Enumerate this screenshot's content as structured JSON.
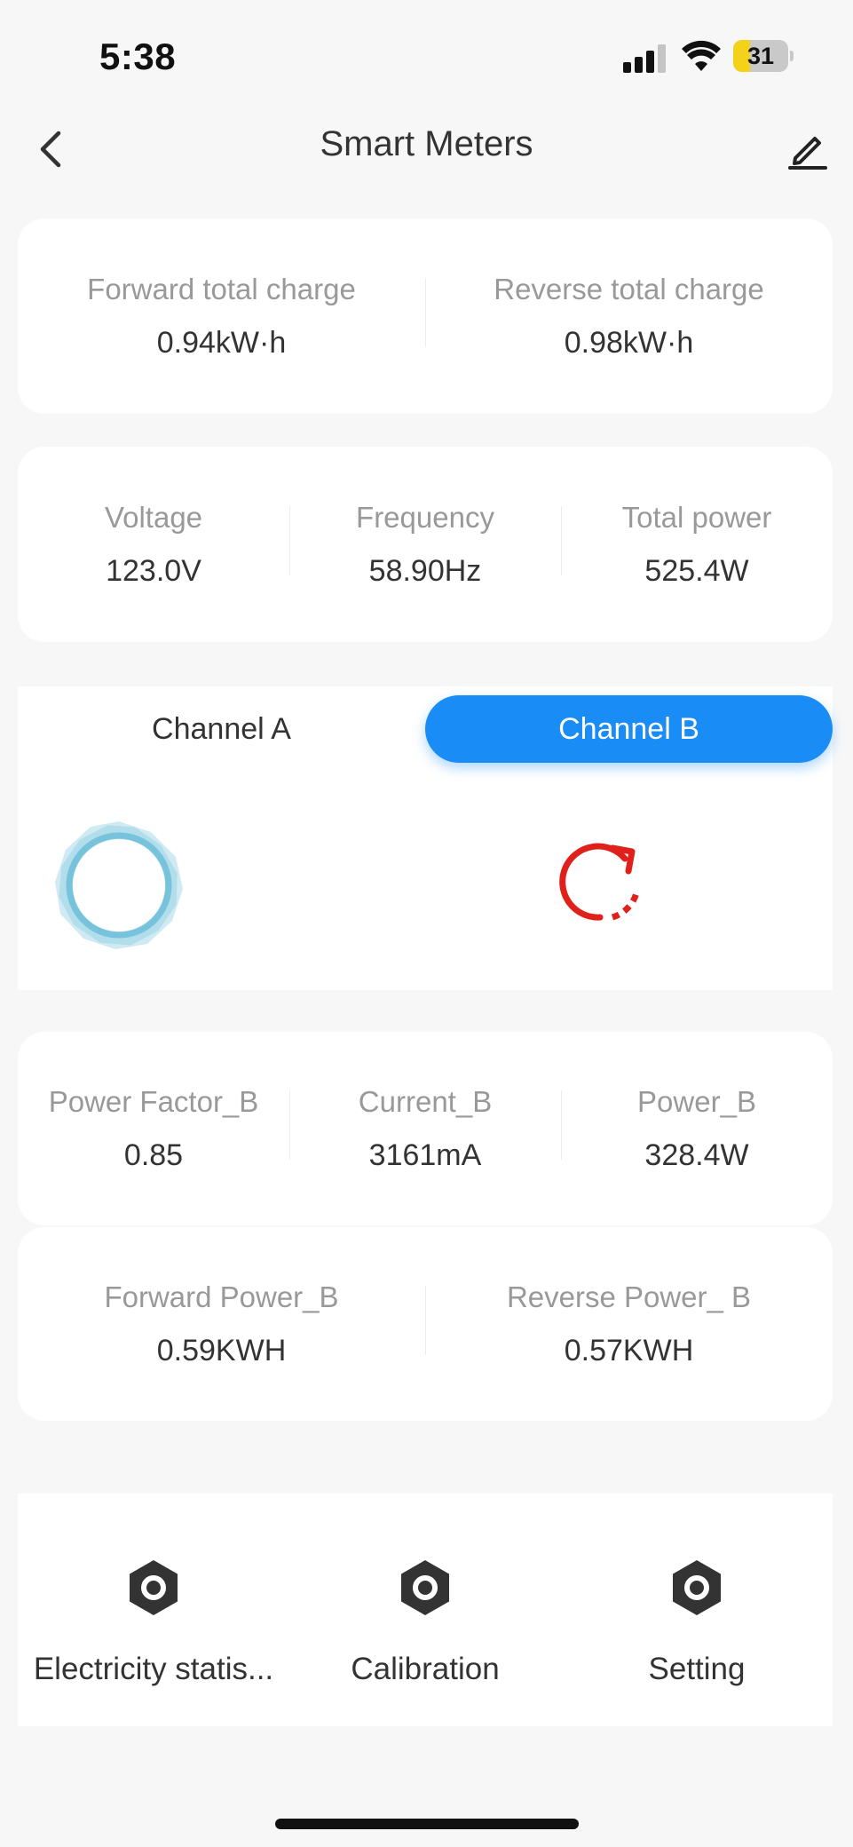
{
  "status_bar": {
    "time": "5:38",
    "battery_percent": 31,
    "battery_label": "31",
    "battery_color": "#f5d21a",
    "signal_bars_active": 3,
    "icons": [
      "cellular-signal-icon",
      "wifi-icon",
      "battery-icon"
    ]
  },
  "nav": {
    "title": "Smart Meters",
    "back_icon": "chevron-left-icon",
    "edit_icon": "pencil-icon"
  },
  "charge_totals": [
    {
      "label": "Forward total charge",
      "value": "0.94kW·h"
    },
    {
      "label": "Reverse total charge",
      "value": "0.98kW·h"
    }
  ],
  "measurements": [
    {
      "label": "Voltage",
      "value": "123.0V"
    },
    {
      "label": "Frequency",
      "value": "58.90Hz"
    },
    {
      "label": "Total power",
      "value": "525.4W"
    }
  ],
  "channels": {
    "tabs": [
      {
        "label": "Channel A",
        "active": false
      },
      {
        "label": "Channel B",
        "active": true
      }
    ],
    "accent_color": "#1a8cf5",
    "loader_icon": "loading-ring-icon",
    "refresh_icon": "refresh-icon",
    "refresh_color": "#e0211b"
  },
  "channel_stats": [
    {
      "label": "Power Factor_B",
      "value": "0.85"
    },
    {
      "label": "Current_B",
      "value": "3161mA"
    },
    {
      "label": "Power_B",
      "value": "328.4W"
    }
  ],
  "channel_energy": [
    {
      "label": "Forward Power_B",
      "value": "0.59KWH"
    },
    {
      "label": "Reverse Power_ B",
      "value": "0.57KWH"
    }
  ],
  "actions": [
    {
      "label": "Electricity statis...",
      "icon": "hexagon-settings-icon"
    },
    {
      "label": "Calibration",
      "icon": "hexagon-settings-icon"
    },
    {
      "label": "Setting",
      "icon": "hexagon-settings-icon"
    }
  ]
}
